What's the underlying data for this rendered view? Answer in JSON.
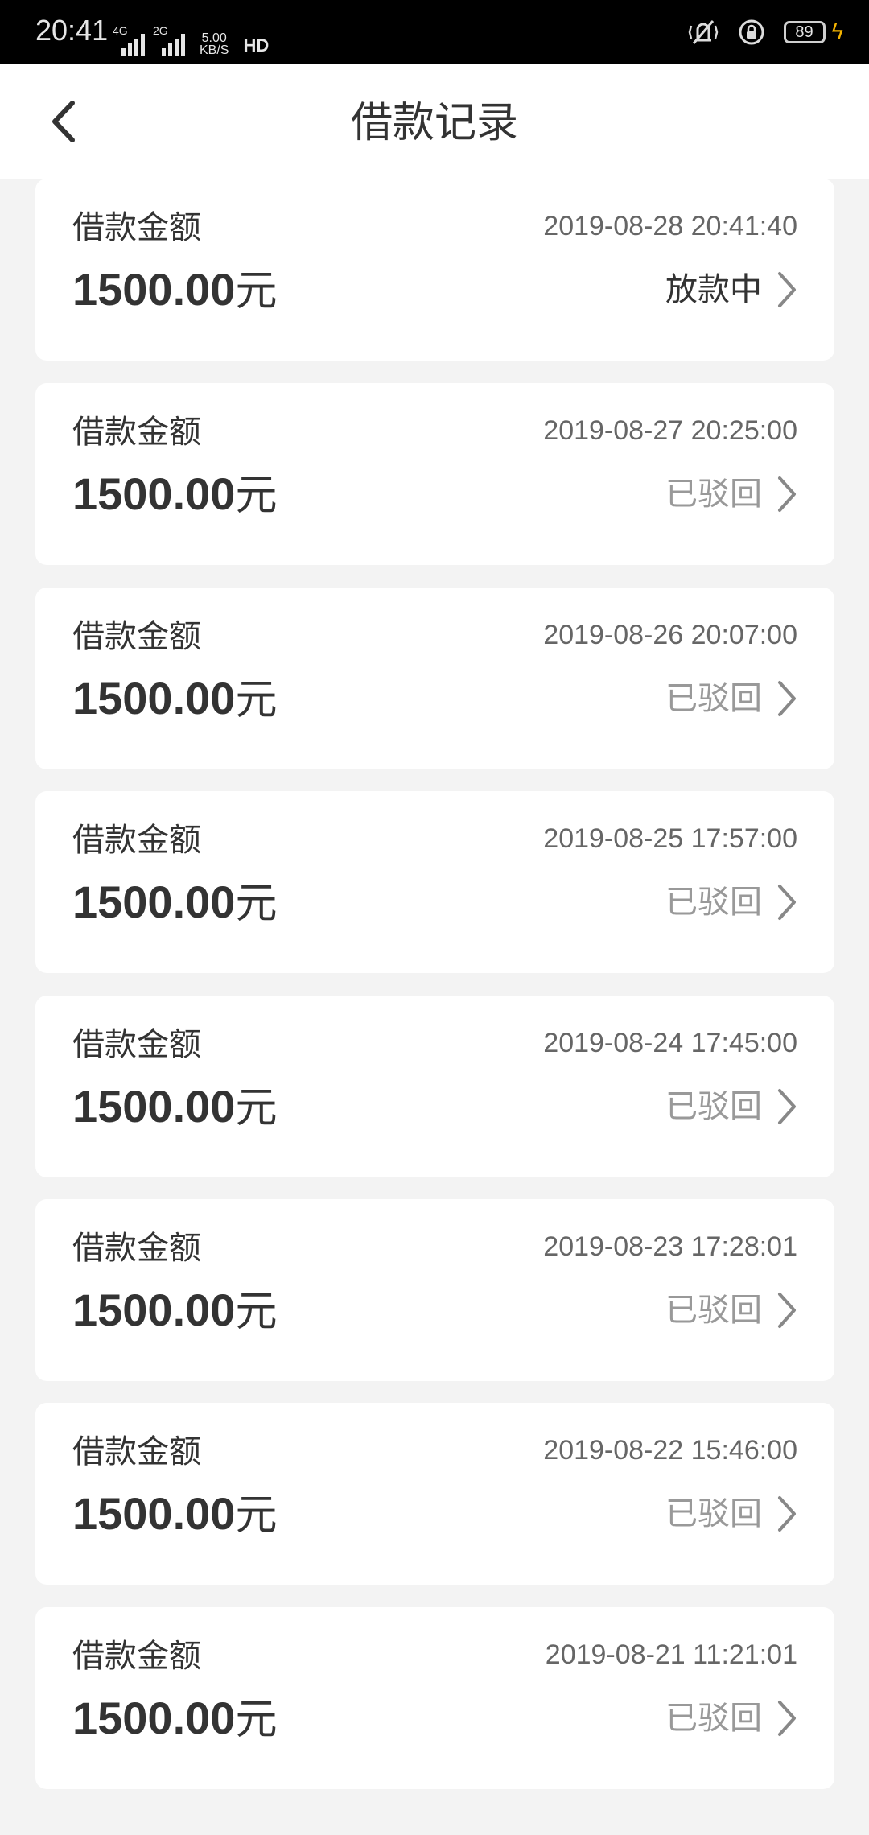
{
  "status_bar": {
    "time": "20:41",
    "signal1_tag": "4G",
    "signal2_tag": "2G",
    "net_speed_value": "5.00",
    "net_speed_unit": "KB/S",
    "hd_label": "HD",
    "battery_level": "89",
    "icons": [
      "vibrate-icon",
      "screen-lock-icon",
      "battery-icon",
      "charging-icon"
    ]
  },
  "header": {
    "title": "借款记录",
    "back_icon": "chevron-left-icon"
  },
  "records": [
    {
      "label": "借款金额",
      "amount": "1500.00",
      "unit": "元",
      "time": "2019-08-28 20:41:40",
      "status": "放款中",
      "status_active": true
    },
    {
      "label": "借款金额",
      "amount": "1500.00",
      "unit": "元",
      "time": "2019-08-27 20:25:00",
      "status": "已驳回",
      "status_active": false
    },
    {
      "label": "借款金额",
      "amount": "1500.00",
      "unit": "元",
      "time": "2019-08-26 20:07:00",
      "status": "已驳回",
      "status_active": false
    },
    {
      "label": "借款金额",
      "amount": "1500.00",
      "unit": "元",
      "time": "2019-08-25 17:57:00",
      "status": "已驳回",
      "status_active": false
    },
    {
      "label": "借款金额",
      "amount": "1500.00",
      "unit": "元",
      "time": "2019-08-24 17:45:00",
      "status": "已驳回",
      "status_active": false
    },
    {
      "label": "借款金额",
      "amount": "1500.00",
      "unit": "元",
      "time": "2019-08-23 17:28:01",
      "status": "已驳回",
      "status_active": false
    },
    {
      "label": "借款金额",
      "amount": "1500.00",
      "unit": "元",
      "time": "2019-08-22 15:46:00",
      "status": "已驳回",
      "status_active": false
    },
    {
      "label": "借款金额",
      "amount": "1500.00",
      "unit": "元",
      "time": "2019-08-21 11:21:01",
      "status": "已驳回",
      "status_active": false
    }
  ],
  "colors": {
    "background": "#f3f3f3",
    "card": "#ffffff",
    "text_primary": "#333333",
    "text_secondary": "#666666",
    "status_muted": "#999999",
    "charging": "#f5b400"
  }
}
